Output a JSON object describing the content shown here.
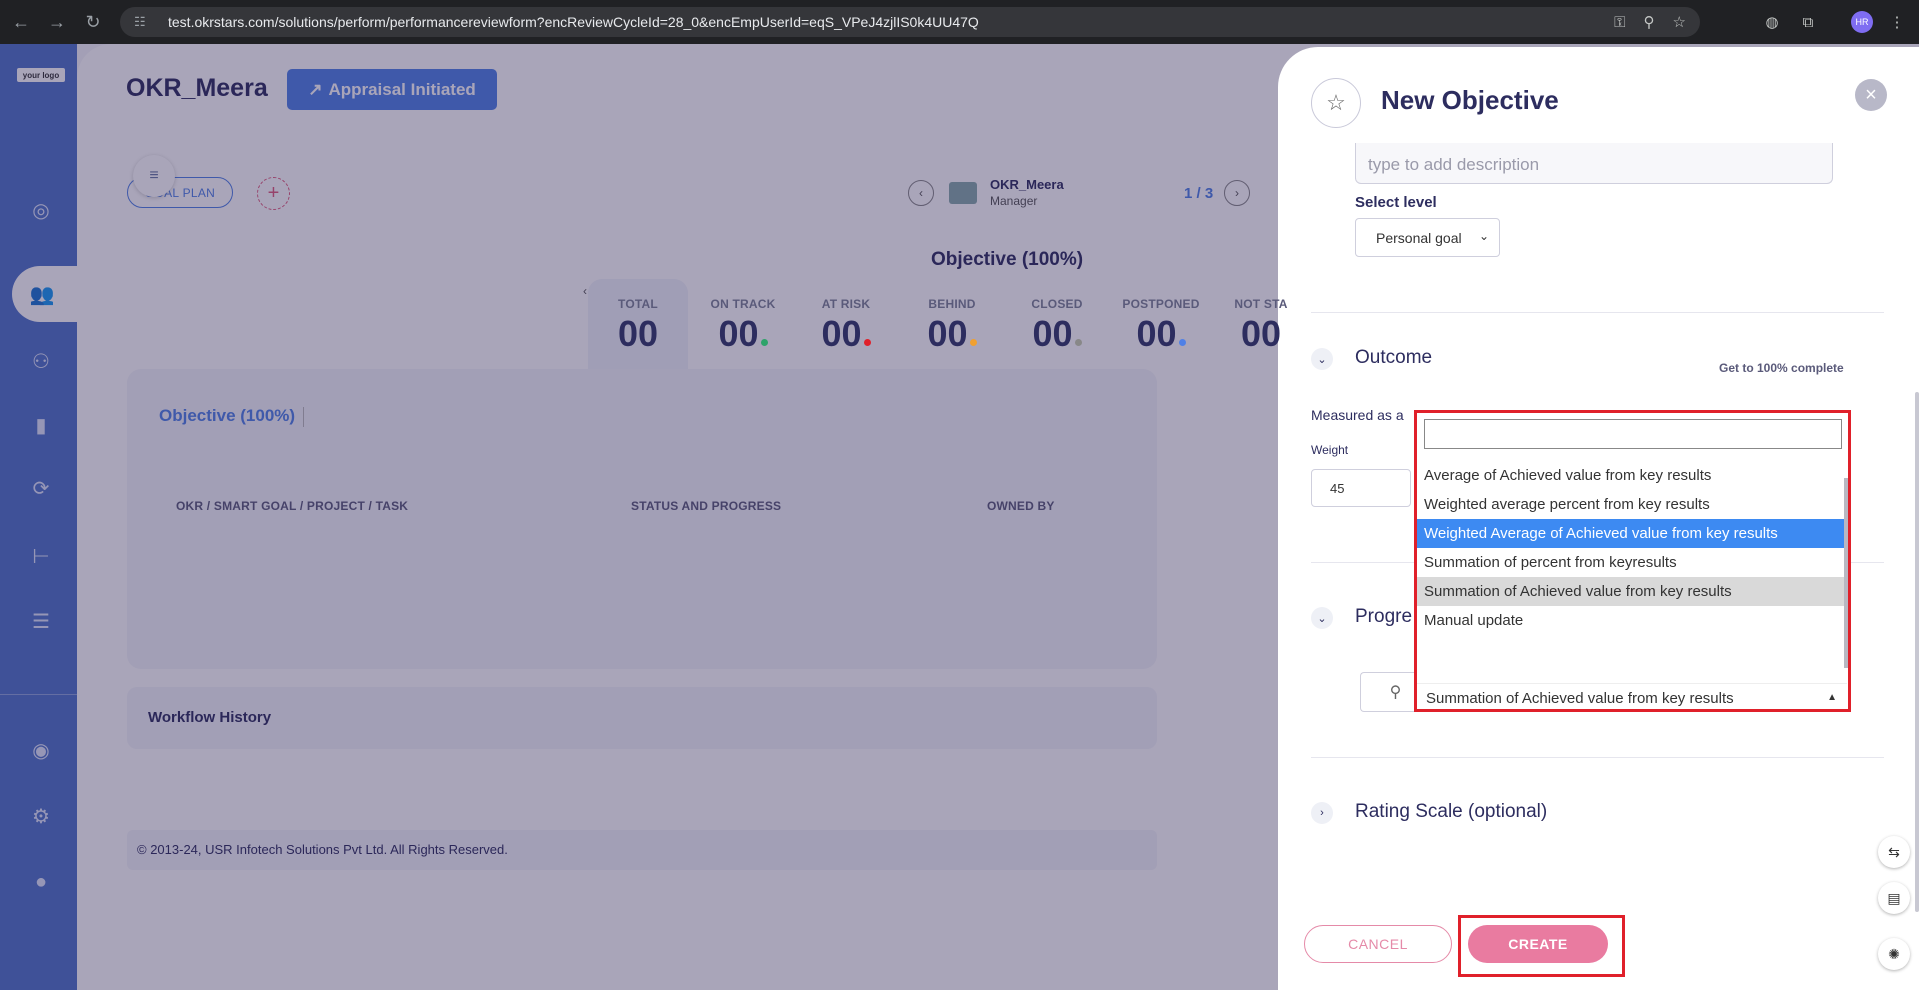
{
  "browser": {
    "url": "test.okrstars.com/solutions/perform/performancereviewform?encReviewCycleId=28_0&encEmpUserId=eqS_VPeJ4zjlIS0k4UU47Q",
    "profile": "HR"
  },
  "sidebar": {
    "logo": "your logo"
  },
  "main": {
    "title": "OKR_Meera",
    "appraisal_button": "Appraisal Initiated",
    "goal_plan": "GOAL PLAN",
    "employee_name": "OKR_Meera",
    "employee_role": "Manager",
    "pager": "1 / 3",
    "objective_heading": "Objective (100%)",
    "stats": [
      {
        "label": "TOTAL",
        "value": "00",
        "color": ""
      },
      {
        "label": "ON TRACK",
        "value": "00",
        "color": "#2ea36a"
      },
      {
        "label": "AT RISK",
        "value": "00",
        "color": "#e0202a"
      },
      {
        "label": "BEHIND",
        "value": "00",
        "color": "#f0a030"
      },
      {
        "label": "CLOSED",
        "value": "00",
        "color": "#888888"
      },
      {
        "label": "POSTPONED",
        "value": "00",
        "color": "#4f80e6"
      },
      {
        "label": "NOT STA",
        "value": "00",
        "color": ""
      }
    ],
    "table_tab": "Objective (100%)",
    "table_headers": [
      "OKR / SMART GOAL / PROJECT / TASK",
      "STATUS AND PROGRESS",
      "OWNED BY"
    ],
    "workflow": "Workflow History",
    "footer": "© 2013-24, USR Infotech Solutions Pvt Ltd. All Rights Reserved."
  },
  "panel": {
    "title": "New Objective",
    "description_placeholder": "type to add description",
    "level_label": "Select level",
    "level_value": "Personal goal",
    "outcome_title": "Outcome",
    "outcome_note": "Get to 100% complete",
    "measured_label": "Measured as a",
    "weight_label": "Weight",
    "weight_value": "45",
    "progress_title": "Progre",
    "rating_title": "Rating Scale (optional)",
    "cancel": "CANCEL",
    "create": "CREATE"
  },
  "dropdown": {
    "options": [
      "Average of Achieved value from key results",
      "Weighted average percent from key results",
      "Weighted Average of Achieved value from key results",
      "Summation of percent from keyresults",
      "Summation of Achieved value from key results",
      "Manual update"
    ],
    "highlighted": "Weighted Average of Achieved value from key results",
    "hovered": "Summation of Achieved value from key results",
    "selected": "Summation of Achieved value from key results"
  }
}
